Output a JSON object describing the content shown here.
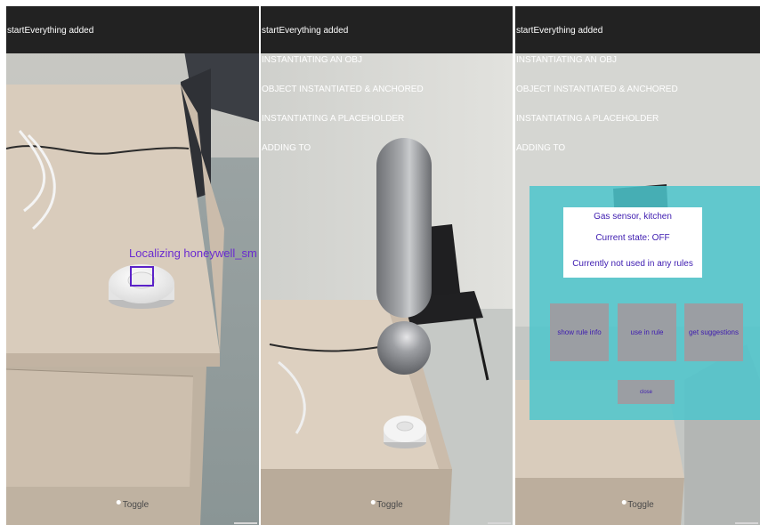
{
  "panels": [
    {
      "log_lines": [
        "startEverything added"
      ],
      "tracking_label": "Localizing honeywell_sm",
      "toggle_label": "Toggle"
    },
    {
      "log_lines": [
        "startEverything added",
        "INSTANTIATING AN OBJ",
        "OBJECT INSTANTIATED & ANCHORED",
        "INSTANTIATING A PLACEHOLDER",
        "ADDING TO"
      ],
      "toggle_label": "Toggle"
    },
    {
      "log_lines": [
        "startEverything added",
        "INSTANTIATING AN OBJ",
        "OBJECT INSTANTIATED & ANCHORED",
        "INSTANTIATING A PLACEHOLDER",
        "ADDING TO"
      ],
      "toggle_label": "Toggle",
      "device_info": {
        "title": "Gas sensor, kitchen",
        "state": "Current state: OFF",
        "rules": "Currently not used in any rules"
      },
      "buttons": {
        "show_rule_info": "show rule info",
        "use_in_rule": "use in rule",
        "get_suggestions": "get suggestions",
        "close": "close"
      }
    }
  ],
  "colors": {
    "overlay": "#4cc6cc",
    "button": "#9b9ea3",
    "ui_text": "#3d1bb0",
    "tracking": "#5b22c8"
  }
}
